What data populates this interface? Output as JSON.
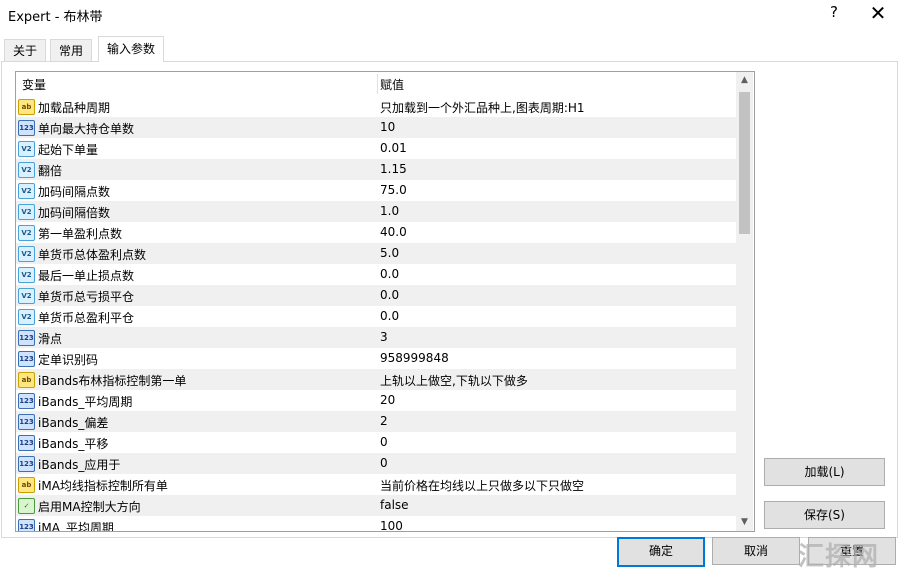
{
  "window": {
    "title": "Expert - 布林带",
    "help_glyph": "?",
    "close_glyph": "✕"
  },
  "tabs": [
    {
      "label": "关于",
      "active": false
    },
    {
      "label": "常用",
      "active": false
    },
    {
      "label": "输入参数",
      "active": true
    }
  ],
  "grid": {
    "headers": {
      "variable": "变量",
      "value": "赋值"
    },
    "rows": [
      {
        "type": "string",
        "icon": "ab",
        "name": "加载品种周期",
        "value": "只加载到一个外汇品种上,图表周期:H1"
      },
      {
        "type": "int",
        "icon": "123",
        "name": "单向最大持仓单数",
        "value": "10"
      },
      {
        "type": "double",
        "icon": "V2",
        "name": "起始下单量",
        "value": "0.01"
      },
      {
        "type": "double",
        "icon": "V2",
        "name": "翻倍",
        "value": "1.15"
      },
      {
        "type": "double",
        "icon": "V2",
        "name": "加码间隔点数",
        "value": "75.0"
      },
      {
        "type": "double",
        "icon": "V2",
        "name": "加码间隔倍数",
        "value": "1.0"
      },
      {
        "type": "double",
        "icon": "V2",
        "name": "第一单盈利点数",
        "value": "40.0"
      },
      {
        "type": "double",
        "icon": "V2",
        "name": "单货币总体盈利点数",
        "value": "5.0"
      },
      {
        "type": "double",
        "icon": "V2",
        "name": "最后一单止损点数",
        "value": "0.0"
      },
      {
        "type": "double",
        "icon": "V2",
        "name": "单货币总亏损平仓",
        "value": "0.0"
      },
      {
        "type": "double",
        "icon": "V2",
        "name": "单货币总盈利平仓",
        "value": "0.0"
      },
      {
        "type": "int",
        "icon": "123",
        "name": "滑点",
        "value": "3"
      },
      {
        "type": "int",
        "icon": "123",
        "name": "定单识别码",
        "value": "958999848"
      },
      {
        "type": "string",
        "icon": "ab",
        "name": "iBands布林指标控制第一单",
        "value": "上轨以上做空,下轨以下做多"
      },
      {
        "type": "int",
        "icon": "123",
        "name": "iBands_平均周期",
        "value": "20"
      },
      {
        "type": "int",
        "icon": "123",
        "name": "iBands_偏差",
        "value": "2"
      },
      {
        "type": "int",
        "icon": "123",
        "name": "iBands_平移",
        "value": "0"
      },
      {
        "type": "int",
        "icon": "123",
        "name": "iBands_应用于",
        "value": "0"
      },
      {
        "type": "string",
        "icon": "ab",
        "name": "iMA均线指标控制所有单",
        "value": "当前价格在均线以上只做多以下只做空"
      },
      {
        "type": "bool",
        "icon": "✓",
        "name": "启用MA控制大方向",
        "value": "false"
      },
      {
        "type": "int",
        "icon": "123",
        "name": "iMA_平均周期",
        "value": "100"
      }
    ],
    "scroll_up_glyph": "▲",
    "scroll_down_glyph": "▼"
  },
  "buttons": {
    "load": "加载(L)",
    "save": "保存(S)",
    "ok": "确定",
    "cancel": "取消",
    "reset": "重置"
  },
  "watermark": "汇探网"
}
